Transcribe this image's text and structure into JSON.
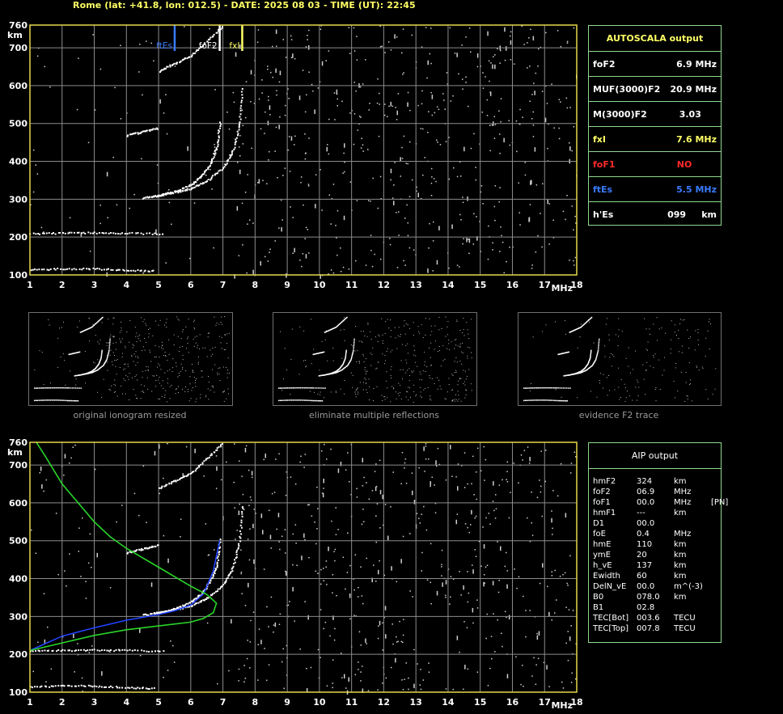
{
  "header": "Rome (lat: +41.8, lon: 012.5) - DATE: 2025 08 03 - TIME (UT): 22:45",
  "colors": {
    "frame": "#e6d84a",
    "grid": "#8c8c8c",
    "panel_border": "#8fd98f",
    "yellow": "#ffff66",
    "red": "#ff2a2a",
    "blue": "#3a7bff",
    "green": "#29d629",
    "trace_blue": "#2244ff"
  },
  "autoscala": {
    "title": "AUTOSCALA output",
    "rows": [
      {
        "label": "foF2",
        "value": "6.9 MHz",
        "color": "#ffffff"
      },
      {
        "label": "MUF(3000)F2",
        "value": "20.9 MHz",
        "color": "#ffffff"
      },
      {
        "label": "M(3000)F2",
        "value": "3.03     ",
        "color": "#ffffff"
      },
      {
        "label": "fxI",
        "value": "7.6 MHz",
        "color": "#ffff66"
      },
      {
        "label": "foF1",
        "value": "NO        ",
        "color": "#ff2a2a"
      },
      {
        "label": "ftEs",
        "value": "5.5 MHz",
        "color": "#3a7bff"
      },
      {
        "label": "h'Es",
        "value": "099     km",
        "color": "#ffffff"
      }
    ]
  },
  "aip": {
    "title": "AIP output",
    "rows": [
      {
        "name": "hmF2",
        "value": "324",
        "unit": "km",
        "extra": ""
      },
      {
        "name": "foF2",
        "value": "06.9",
        "unit": "MHz",
        "extra": ""
      },
      {
        "name": "foF1",
        "value": "00.0",
        "unit": "MHz",
        "extra": "[PN]"
      },
      {
        "name": "hmF1",
        "value": "---",
        "unit": "km",
        "extra": ""
      },
      {
        "name": "D1",
        "value": "00.0",
        "unit": "",
        "extra": ""
      },
      {
        "name": "foE",
        "value": "0.4",
        "unit": "MHz",
        "extra": ""
      },
      {
        "name": "hmE",
        "value": "110",
        "unit": "km",
        "extra": ""
      },
      {
        "name": "ymE",
        "value": "20",
        "unit": "km",
        "extra": ""
      },
      {
        "name": "h_vE",
        "value": "137",
        "unit": "km",
        "extra": ""
      },
      {
        "name": "Ewidth",
        "value": "60",
        "unit": "km",
        "extra": ""
      },
      {
        "name": "DelN_vE",
        "value": "00.0",
        "unit": "m^(-3)",
        "extra": ""
      },
      {
        "name": "B0",
        "value": "078.0",
        "unit": "km",
        "extra": ""
      },
      {
        "name": "B1",
        "value": "02.8",
        "unit": "",
        "extra": ""
      },
      {
        "name": "TEC[Bot]",
        "value": "003.6",
        "unit": "TECU",
        "extra": ""
      },
      {
        "name": "TEC[Top]",
        "value": "007.8",
        "unit": "TECU",
        "extra": ""
      }
    ]
  },
  "captions": [
    "original ionogram resized",
    "eliminate multiple reflections",
    "evidence F2 trace"
  ],
  "chart_data": [
    {
      "type": "scatter",
      "title": "",
      "xlabel": "MHz",
      "ylabel": "km",
      "xlim": [
        1,
        18
      ],
      "ylim": [
        100,
        760
      ],
      "x_ticks": [
        1,
        2,
        3,
        4,
        5,
        6,
        7,
        8,
        9,
        10,
        11,
        12,
        13,
        14,
        15,
        16,
        17,
        18
      ],
      "y_ticks": [
        100,
        200,
        300,
        400,
        500,
        600,
        700,
        760
      ],
      "markers": [
        {
          "label": "ftEs",
          "x": 5.5,
          "color": "#3a7bff"
        },
        {
          "label": "foF2",
          "x": 6.9,
          "color": "#ffffff"
        },
        {
          "label": "fxI",
          "x": 7.6,
          "color": "#ffff66"
        }
      ],
      "series": [
        {
          "points": [
            [
              4.5,
              305
            ],
            [
              5.0,
              312
            ],
            [
              5.5,
              322
            ],
            [
              6.0,
              340
            ],
            [
              6.3,
              360
            ],
            [
              6.6,
              395
            ],
            [
              6.8,
              440
            ],
            [
              6.9,
              510
            ]
          ]
        },
        {
          "points": [
            [
              4.9,
              310
            ],
            [
              5.5,
              320
            ],
            [
              6.0,
              330
            ],
            [
              6.5,
              350
            ],
            [
              7.0,
              385
            ],
            [
              7.3,
              430
            ],
            [
              7.5,
              500
            ],
            [
              7.6,
              600
            ]
          ]
        },
        {
          "points": [
            [
              1.0,
              210
            ],
            [
              2.0,
              212
            ],
            [
              3.0,
              213
            ],
            [
              4.0,
              212
            ],
            [
              5.2,
              210
            ]
          ]
        },
        {
          "points": [
            [
              1.0,
              115
            ],
            [
              2.0,
              118
            ],
            [
              3.0,
              118
            ],
            [
              4.0,
              114
            ],
            [
              4.9,
              112
            ]
          ]
        },
        {
          "points": [
            [
              5.0,
              640
            ],
            [
              5.5,
              660
            ],
            [
              6.0,
              680
            ],
            [
              6.5,
              720
            ],
            [
              7.0,
              760
            ]
          ]
        },
        {
          "points": [
            [
              4.0,
              470
            ],
            [
              4.5,
              480
            ],
            [
              5.0,
              490
            ]
          ]
        }
      ]
    },
    {
      "type": "scatter",
      "title": "",
      "xlabel": "MHz",
      "ylabel": "km",
      "xlim": [
        1,
        18
      ],
      "ylim": [
        100,
        760
      ],
      "x_ticks": [
        1,
        2,
        3,
        4,
        5,
        6,
        7,
        8,
        9,
        10,
        11,
        12,
        13,
        14,
        15,
        16,
        17,
        18
      ],
      "y_ticks": [
        100,
        200,
        300,
        400,
        500,
        600,
        700,
        760
      ],
      "series": [
        {
          "points": [
            [
              4.5,
              305
            ],
            [
              5.0,
              312
            ],
            [
              5.5,
              322
            ],
            [
              6.0,
              340
            ],
            [
              6.3,
              360
            ],
            [
              6.6,
              395
            ],
            [
              6.8,
              440
            ],
            [
              6.9,
              510
            ]
          ]
        },
        {
          "points": [
            [
              4.9,
              310
            ],
            [
              5.5,
              320
            ],
            [
              6.0,
              330
            ],
            [
              6.5,
              350
            ],
            [
              7.0,
              385
            ],
            [
              7.3,
              430
            ],
            [
              7.5,
              500
            ],
            [
              7.6,
              600
            ]
          ]
        },
        {
          "points": [
            [
              1.0,
              210
            ],
            [
              2.0,
              212
            ],
            [
              3.0,
              213
            ],
            [
              4.0,
              212
            ],
            [
              5.2,
              210
            ]
          ]
        },
        {
          "points": [
            [
              1.0,
              115
            ],
            [
              2.0,
              118
            ],
            [
              3.0,
              118
            ],
            [
              4.0,
              114
            ],
            [
              4.9,
              112
            ]
          ]
        },
        {
          "points": [
            [
              5.0,
              640
            ],
            [
              5.5,
              660
            ],
            [
              6.0,
              680
            ],
            [
              6.5,
              720
            ],
            [
              7.0,
              760
            ]
          ]
        },
        {
          "points": [
            [
              4.0,
              470
            ],
            [
              4.5,
              480
            ],
            [
              5.0,
              490
            ]
          ]
        },
        {
          "style": "line",
          "color": "#2244ff",
          "points": [
            [
              1.0,
              210
            ],
            [
              2.0,
              248
            ],
            [
              3.0,
              270
            ],
            [
              4.0,
              290
            ],
            [
              5.0,
              305
            ],
            [
              5.5,
              315
            ],
            [
              6.0,
              330
            ],
            [
              6.4,
              360
            ],
            [
              6.7,
              420
            ],
            [
              6.9,
              500
            ]
          ]
        },
        {
          "style": "line",
          "color": "#29d629",
          "points": [
            [
              1.2,
              760
            ],
            [
              1.5,
              720
            ],
            [
              2.0,
              650
            ],
            [
              2.5,
              600
            ],
            [
              3.0,
              550
            ],
            [
              3.5,
              510
            ],
            [
              4.0,
              480
            ],
            [
              4.5,
              455
            ],
            [
              5.0,
              430
            ],
            [
              5.5,
              405
            ],
            [
              6.0,
              380
            ],
            [
              6.5,
              358
            ],
            [
              6.8,
              335
            ],
            [
              6.7,
              310
            ],
            [
              6.4,
              295
            ],
            [
              6.0,
              285
            ],
            [
              5.0,
              275
            ],
            [
              4.0,
              265
            ],
            [
              3.0,
              250
            ],
            [
              2.0,
              230
            ],
            [
              1.0,
              210
            ]
          ]
        }
      ]
    }
  ]
}
